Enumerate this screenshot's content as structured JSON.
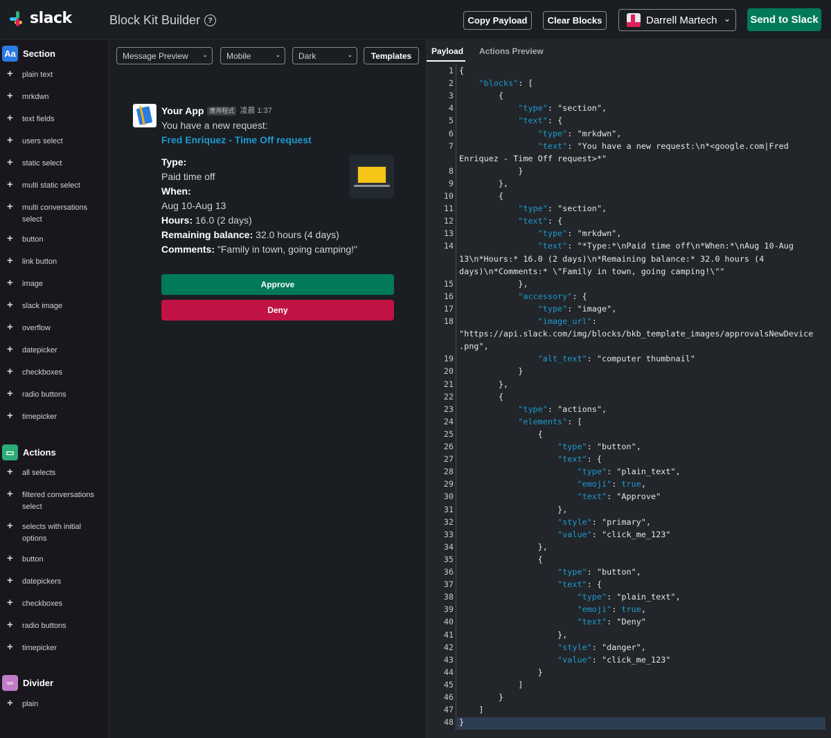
{
  "topbar": {
    "logo_text": "slack",
    "app_title": "Block Kit Builder",
    "help_glyph": "?",
    "copy_payload": "Copy Payload",
    "clear_blocks": "Clear Blocks",
    "user_name": "Darrell Martech",
    "send_to_slack": "Send to Slack"
  },
  "sidebar": {
    "sections": [
      {
        "label": "Section",
        "icon": "Aa",
        "icon_color": "#2a7be4",
        "items": [
          "plain text",
          "mrkdwn",
          "text fields",
          "users select",
          "static select",
          "multi static select",
          "multi conversations select",
          "button",
          "link button",
          "image",
          "slack image",
          "overflow",
          "datepicker",
          "checkboxes",
          "radio buttons",
          "timepicker"
        ]
      },
      {
        "label": "Actions",
        "icon": "▭",
        "icon_color": "#2bac76",
        "items": [
          "all selects",
          "filtered conversations select",
          "selects with initial options",
          "button",
          "datepickers",
          "checkboxes",
          "radio buttons",
          "timepicker"
        ]
      },
      {
        "label": "Divider",
        "icon": "═",
        "icon_color": "#c07cc7",
        "items": [
          "plain"
        ]
      }
    ]
  },
  "preview": {
    "preview_mode": "Message Preview",
    "device": "Mobile",
    "theme": "Dark",
    "templates": "Templates",
    "message": {
      "app_name": "Your App",
      "app_badge": "應用程式",
      "time": "凌晨 1:37",
      "line1": "You have a new request:",
      "link": "Fred Enriquez - Time Off request",
      "type_label": "Type:",
      "type_value": "Paid time off",
      "when_label": "When:",
      "when_value": "Aug 10-Aug 13",
      "hours_label": "Hours:",
      "hours_value": " 16.0 (2 days)",
      "balance_label": "Remaining balance:",
      "balance_value": " 32.0 hours (4 days)",
      "comments_label": "Comments:",
      "comments_value": " \"Family in town, going camping!\"",
      "approve": "Approve",
      "deny": "Deny"
    }
  },
  "payload_panel": {
    "tab_payload": "Payload",
    "tab_actions_preview": "Actions Preview",
    "line_numbers": [
      1,
      2,
      3,
      4,
      5,
      6,
      7,
      8,
      9,
      10,
      11,
      12,
      13,
      14,
      15,
      16,
      17,
      18,
      19,
      20,
      21,
      22,
      23,
      24,
      25,
      26,
      27,
      28,
      29,
      30,
      31,
      32,
      33,
      34,
      35,
      36,
      37,
      38,
      39,
      40,
      41,
      42,
      43,
      44,
      45,
      46,
      47,
      48
    ],
    "code_lines": [
      [
        {
          "t": "p",
          "v": "{"
        }
      ],
      [
        {
          "t": "p",
          "v": "    "
        },
        {
          "t": "k",
          "v": "\"blocks\""
        },
        {
          "t": "p",
          "v": ": ["
        }
      ],
      [
        {
          "t": "p",
          "v": "        {"
        }
      ],
      [
        {
          "t": "p",
          "v": "            "
        },
        {
          "t": "k",
          "v": "\"type\""
        },
        {
          "t": "p",
          "v": ": \"section\","
        }
      ],
      [
        {
          "t": "p",
          "v": "            "
        },
        {
          "t": "k",
          "v": "\"text\""
        },
        {
          "t": "p",
          "v": ": {"
        }
      ],
      [
        {
          "t": "p",
          "v": "                "
        },
        {
          "t": "k",
          "v": "\"type\""
        },
        {
          "t": "p",
          "v": ": \"mrkdwn\","
        }
      ],
      [
        {
          "t": "p",
          "v": "                "
        },
        {
          "t": "k",
          "v": "\"text\""
        },
        {
          "t": "p",
          "v": ": \"You have a new request:\\n*<google.com|Fred"
        }
      ],
      [
        {
          "t": "p",
          "v": "Enriquez - Time Off request>*\""
        }
      ],
      [
        {
          "t": "p",
          "v": "            }"
        }
      ],
      [
        {
          "t": "p",
          "v": "        },"
        }
      ],
      [
        {
          "t": "p",
          "v": "        {"
        }
      ],
      [
        {
          "t": "p",
          "v": "            "
        },
        {
          "t": "k",
          "v": "\"type\""
        },
        {
          "t": "p",
          "v": ": \"section\","
        }
      ],
      [
        {
          "t": "p",
          "v": "            "
        },
        {
          "t": "k",
          "v": "\"text\""
        },
        {
          "t": "p",
          "v": ": {"
        }
      ],
      [
        {
          "t": "p",
          "v": "                "
        },
        {
          "t": "k",
          "v": "\"type\""
        },
        {
          "t": "p",
          "v": ": \"mrkdwn\","
        }
      ],
      [
        {
          "t": "p",
          "v": "                "
        },
        {
          "t": "k",
          "v": "\"text\""
        },
        {
          "t": "p",
          "v": ": \"*Type:*\\nPaid time off\\n*When:*\\nAug 10-Aug"
        }
      ],
      [
        {
          "t": "p",
          "v": "13\\n*Hours:* 16.0 (2 days)\\n*Remaining balance:* 32.0 hours (4"
        }
      ],
      [
        {
          "t": "p",
          "v": "days)\\n*Comments:* \\\"Family in town, going camping!\\\"\""
        }
      ],
      [
        {
          "t": "p",
          "v": "            },"
        }
      ],
      [
        {
          "t": "p",
          "v": "            "
        },
        {
          "t": "k",
          "v": "\"accessory\""
        },
        {
          "t": "p",
          "v": ": {"
        }
      ],
      [
        {
          "t": "p",
          "v": "                "
        },
        {
          "t": "k",
          "v": "\"type\""
        },
        {
          "t": "p",
          "v": ": \"image\","
        }
      ],
      [
        {
          "t": "p",
          "v": "                "
        },
        {
          "t": "k",
          "v": "\"image_url\""
        },
        {
          "t": "p",
          "v": ":"
        }
      ],
      [
        {
          "t": "p",
          "v": "\"https://api.slack.com/img/blocks/bkb_template_images/approvalsNewDevice"
        }
      ],
      [
        {
          "t": "p",
          "v": ".png\","
        }
      ],
      [
        {
          "t": "p",
          "v": "                "
        },
        {
          "t": "k",
          "v": "\"alt_text\""
        },
        {
          "t": "p",
          "v": ": \"computer thumbnail\""
        }
      ],
      [
        {
          "t": "p",
          "v": "            }"
        }
      ],
      [
        {
          "t": "p",
          "v": "        },"
        }
      ],
      [
        {
          "t": "p",
          "v": "        {"
        }
      ],
      [
        {
          "t": "p",
          "v": "            "
        },
        {
          "t": "k",
          "v": "\"type\""
        },
        {
          "t": "p",
          "v": ": \"actions\","
        }
      ],
      [
        {
          "t": "p",
          "v": "            "
        },
        {
          "t": "k",
          "v": "\"elements\""
        },
        {
          "t": "p",
          "v": ": ["
        }
      ],
      [
        {
          "t": "p",
          "v": "                {"
        }
      ],
      [
        {
          "t": "p",
          "v": "                    "
        },
        {
          "t": "k",
          "v": "\"type\""
        },
        {
          "t": "p",
          "v": ": \"button\","
        }
      ],
      [
        {
          "t": "p",
          "v": "                    "
        },
        {
          "t": "k",
          "v": "\"text\""
        },
        {
          "t": "p",
          "v": ": {"
        }
      ],
      [
        {
          "t": "p",
          "v": "                        "
        },
        {
          "t": "k",
          "v": "\"type\""
        },
        {
          "t": "p",
          "v": ": \"plain_text\","
        }
      ],
      [
        {
          "t": "p",
          "v": "                        "
        },
        {
          "t": "k",
          "v": "\"emoji\""
        },
        {
          "t": "p",
          "v": ": "
        },
        {
          "t": "b",
          "v": "true"
        },
        {
          "t": "p",
          "v": ","
        }
      ],
      [
        {
          "t": "p",
          "v": "                        "
        },
        {
          "t": "k",
          "v": "\"text\""
        },
        {
          "t": "p",
          "v": ": \"Approve\""
        }
      ],
      [
        {
          "t": "p",
          "v": "                    },"
        }
      ],
      [
        {
          "t": "p",
          "v": "                    "
        },
        {
          "t": "k",
          "v": "\"style\""
        },
        {
          "t": "p",
          "v": ": \"primary\","
        }
      ],
      [
        {
          "t": "p",
          "v": "                    "
        },
        {
          "t": "k",
          "v": "\"value\""
        },
        {
          "t": "p",
          "v": ": \"click_me_123\""
        }
      ],
      [
        {
          "t": "p",
          "v": "                },"
        }
      ],
      [
        {
          "t": "p",
          "v": "                {"
        }
      ],
      [
        {
          "t": "p",
          "v": "                    "
        },
        {
          "t": "k",
          "v": "\"type\""
        },
        {
          "t": "p",
          "v": ": \"button\","
        }
      ],
      [
        {
          "t": "p",
          "v": "                    "
        },
        {
          "t": "k",
          "v": "\"text\""
        },
        {
          "t": "p",
          "v": ": {"
        }
      ],
      [
        {
          "t": "p",
          "v": "                        "
        },
        {
          "t": "k",
          "v": "\"type\""
        },
        {
          "t": "p",
          "v": ": \"plain_text\","
        }
      ],
      [
        {
          "t": "p",
          "v": "                        "
        },
        {
          "t": "k",
          "v": "\"emoji\""
        },
        {
          "t": "p",
          "v": ": "
        },
        {
          "t": "b",
          "v": "true"
        },
        {
          "t": "p",
          "v": ","
        }
      ],
      [
        {
          "t": "p",
          "v": "                        "
        },
        {
          "t": "k",
          "v": "\"text\""
        },
        {
          "t": "p",
          "v": ": \"Deny\""
        }
      ],
      [
        {
          "t": "p",
          "v": "                    },"
        }
      ],
      [
        {
          "t": "p",
          "v": "                    "
        },
        {
          "t": "k",
          "v": "\"style\""
        },
        {
          "t": "p",
          "v": ": \"danger\","
        }
      ],
      [
        {
          "t": "p",
          "v": "                    "
        },
        {
          "t": "k",
          "v": "\"value\""
        },
        {
          "t": "p",
          "v": ": \"click_me_123\""
        }
      ],
      [
        {
          "t": "p",
          "v": "                }"
        }
      ],
      [
        {
          "t": "p",
          "v": "            ]"
        }
      ],
      [
        {
          "t": "p",
          "v": "        }"
        }
      ],
      [
        {
          "t": "p",
          "v": "    ]"
        }
      ],
      [
        {
          "t": "p",
          "v": "}"
        }
      ]
    ],
    "line_number_rows": [
      0,
      1,
      2,
      3,
      4,
      5,
      6,
      8,
      9,
      10,
      11,
      12,
      13,
      14,
      17,
      18,
      19,
      20,
      23,
      24,
      25,
      26,
      27,
      28,
      29,
      30,
      31,
      32,
      33,
      34,
      35,
      36,
      37,
      38,
      39,
      40,
      41,
      42,
      43,
      44,
      45,
      46,
      47,
      48,
      49,
      50,
      51,
      52
    ]
  },
  "colors": {
    "accent_green": "#007a5a",
    "danger_red": "#c01343",
    "link_blue": "#1d9bd1",
    "json_key": "#1d9bd1"
  }
}
